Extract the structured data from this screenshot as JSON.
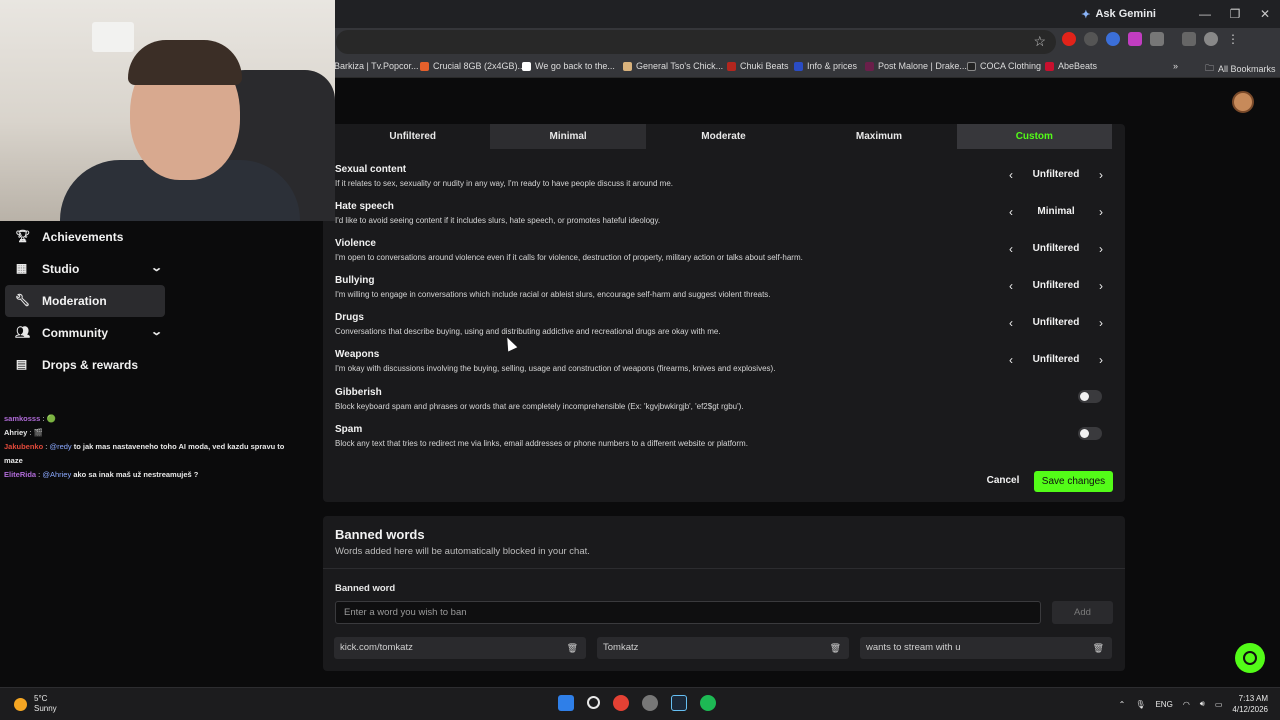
{
  "browser": {
    "ask_gemini": "Ask Gemini",
    "bookmarks": [
      "Barkiza | Tv.Popcor...",
      "Crucial 8GB (2x4GB)...",
      "We go back to the...",
      "General Tso's Chick...",
      "Chuki Beats",
      "Info & prices",
      "Post Malone | Drake...",
      "COCA Clothing",
      "AbeBeats"
    ],
    "all_bookmarks": "All Bookmarks",
    "more_bookmarks": "»"
  },
  "nav": {
    "items": [
      {
        "label": "Achievements",
        "icon": "trophy-icon"
      },
      {
        "label": "Studio",
        "icon": "studio-icon",
        "chevron": "chevron-down-icon"
      },
      {
        "label": "Moderation",
        "icon": "wrench-icon",
        "active": true
      },
      {
        "label": "Community",
        "icon": "community-icon",
        "chevron": "chevron-down-icon"
      },
      {
        "label": "Drops & rewards",
        "icon": "drops-icon"
      }
    ]
  },
  "chat": [
    {
      "user": "samkosss",
      "sep": " : ",
      "text": "🟢"
    },
    {
      "user": "Ahriey",
      "sep": " : ",
      "text": "🎬"
    },
    {
      "user": "Jakubenko",
      "sep": " : ",
      "mention": "@redy",
      "text": " to jak mas nastaveneho toho AI moda, ved kazdu spravu to maze"
    },
    {
      "user": "EliteRida",
      "sep": " : ",
      "mention": "@Ahriey",
      "text": " ako sa inak maš už nestreamuješ ?"
    }
  ],
  "moderation": {
    "levels": [
      "Unfiltered",
      "Minimal",
      "Moderate",
      "Maximum",
      "Custom"
    ],
    "selected_level": "Custom",
    "rules": [
      {
        "title": "Sexual content",
        "desc": "If it relates to sex, sexuality or nudity in any way, I'm ready to have people discuss it around me.",
        "value": "Unfiltered"
      },
      {
        "title": "Hate speech",
        "desc": "I'd like to avoid seeing content if it includes slurs, hate speech, or promotes hateful ideology.",
        "value": "Minimal"
      },
      {
        "title": "Violence",
        "desc": "I'm open to conversations around violence even if it calls for violence, destruction of property, military action or talks about self-harm.",
        "value": "Unfiltered"
      },
      {
        "title": "Bullying",
        "desc": "I'm willing to engage in conversations which include racial or ableist slurs, encourage self-harm and suggest violent threats.",
        "value": "Unfiltered"
      },
      {
        "title": "Drugs",
        "desc": "Conversations that describe buying, using and distributing addictive and recreational drugs are okay with me.",
        "value": "Unfiltered"
      },
      {
        "title": "Weapons",
        "desc": "I'm okay with discussions involving the buying, selling, usage and construction of weapons (firearms, knives and explosives).",
        "value": "Unfiltered"
      }
    ],
    "toggles": [
      {
        "title": "Gibberish",
        "desc": "Block keyboard spam and phrases or words that are completely incomprehensible (Ex: 'kgvjbwkirgjb', 'ef2$gt rgbu').",
        "on": false
      },
      {
        "title": "Spam",
        "desc": "Block any text that tries to redirect me via links, email addresses or phone numbers to a different website or platform.",
        "on": false
      }
    ],
    "cancel": "Cancel",
    "save": "Save changes"
  },
  "banned": {
    "title": "Banned words",
    "subtitle": "Words added here will be automatically blocked in your chat.",
    "label": "Banned word",
    "placeholder": "Enter a word you wish to ban",
    "add": "Add",
    "words": [
      "kick.com/tomkatz",
      "Tomkatz",
      "wants to stream with u"
    ]
  },
  "taskbar": {
    "temp": "5°C",
    "condition": "Sunny",
    "lang": "ENG",
    "time": "7:13 AM",
    "date": "4/12/2026"
  },
  "colors": {
    "accent": "#53fc18",
    "panel": "#1a1a1c",
    "background": "#0b0b0c"
  }
}
